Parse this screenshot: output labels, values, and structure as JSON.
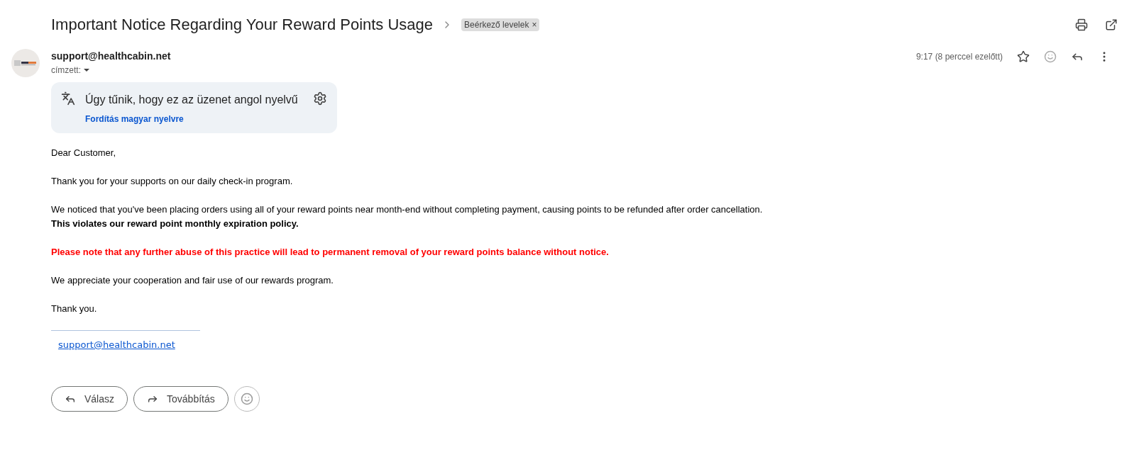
{
  "subject": "Important Notice Regarding Your Reward Points Usage",
  "label": {
    "text": "Beérkező levelek",
    "remove": "×"
  },
  "sender": {
    "email": "support@healthcabin.net",
    "recipient": "címzett:",
    "time": "9:17 (8 perccel ezelőtt)",
    "starred": false
  },
  "translate": {
    "message": "Úgy tűnik, hogy ez az üzenet angol nyelvű",
    "link": "Fordítás magyar nyelvre"
  },
  "body": [
    {
      "lines": [
        {
          "kind": "plain",
          "text": "Dear Customer,"
        }
      ]
    },
    {
      "lines": [
        {
          "kind": "plain",
          "text": "Thank you for your supports on our daily check-in program."
        }
      ]
    },
    {
      "lines": [
        {
          "kind": "plain",
          "text": "We noticed that you've been placing orders using all of your reward points near month-end without completing payment, causing points to be refunded after order cancellation."
        },
        {
          "kind": "bold",
          "text": "This violates our reward point monthly expiration policy."
        }
      ]
    },
    {
      "lines": [
        {
          "kind": "alert",
          "text": "Please note that any further abuse of this practice will lead to permanent removal of your reward points balance without notice."
        }
      ]
    },
    {
      "lines": [
        {
          "kind": "plain",
          "text": "We appreciate your cooperation and fair use of our rewards program."
        }
      ]
    },
    {
      "lines": [
        {
          "kind": "plain",
          "text": "Thank you."
        }
      ]
    }
  ],
  "signature_link": "support@healthcabin.net",
  "actions": [
    {
      "kind": "reply",
      "label": "Válasz"
    },
    {
      "kind": "forward",
      "label": "Továbbítás"
    }
  ]
}
